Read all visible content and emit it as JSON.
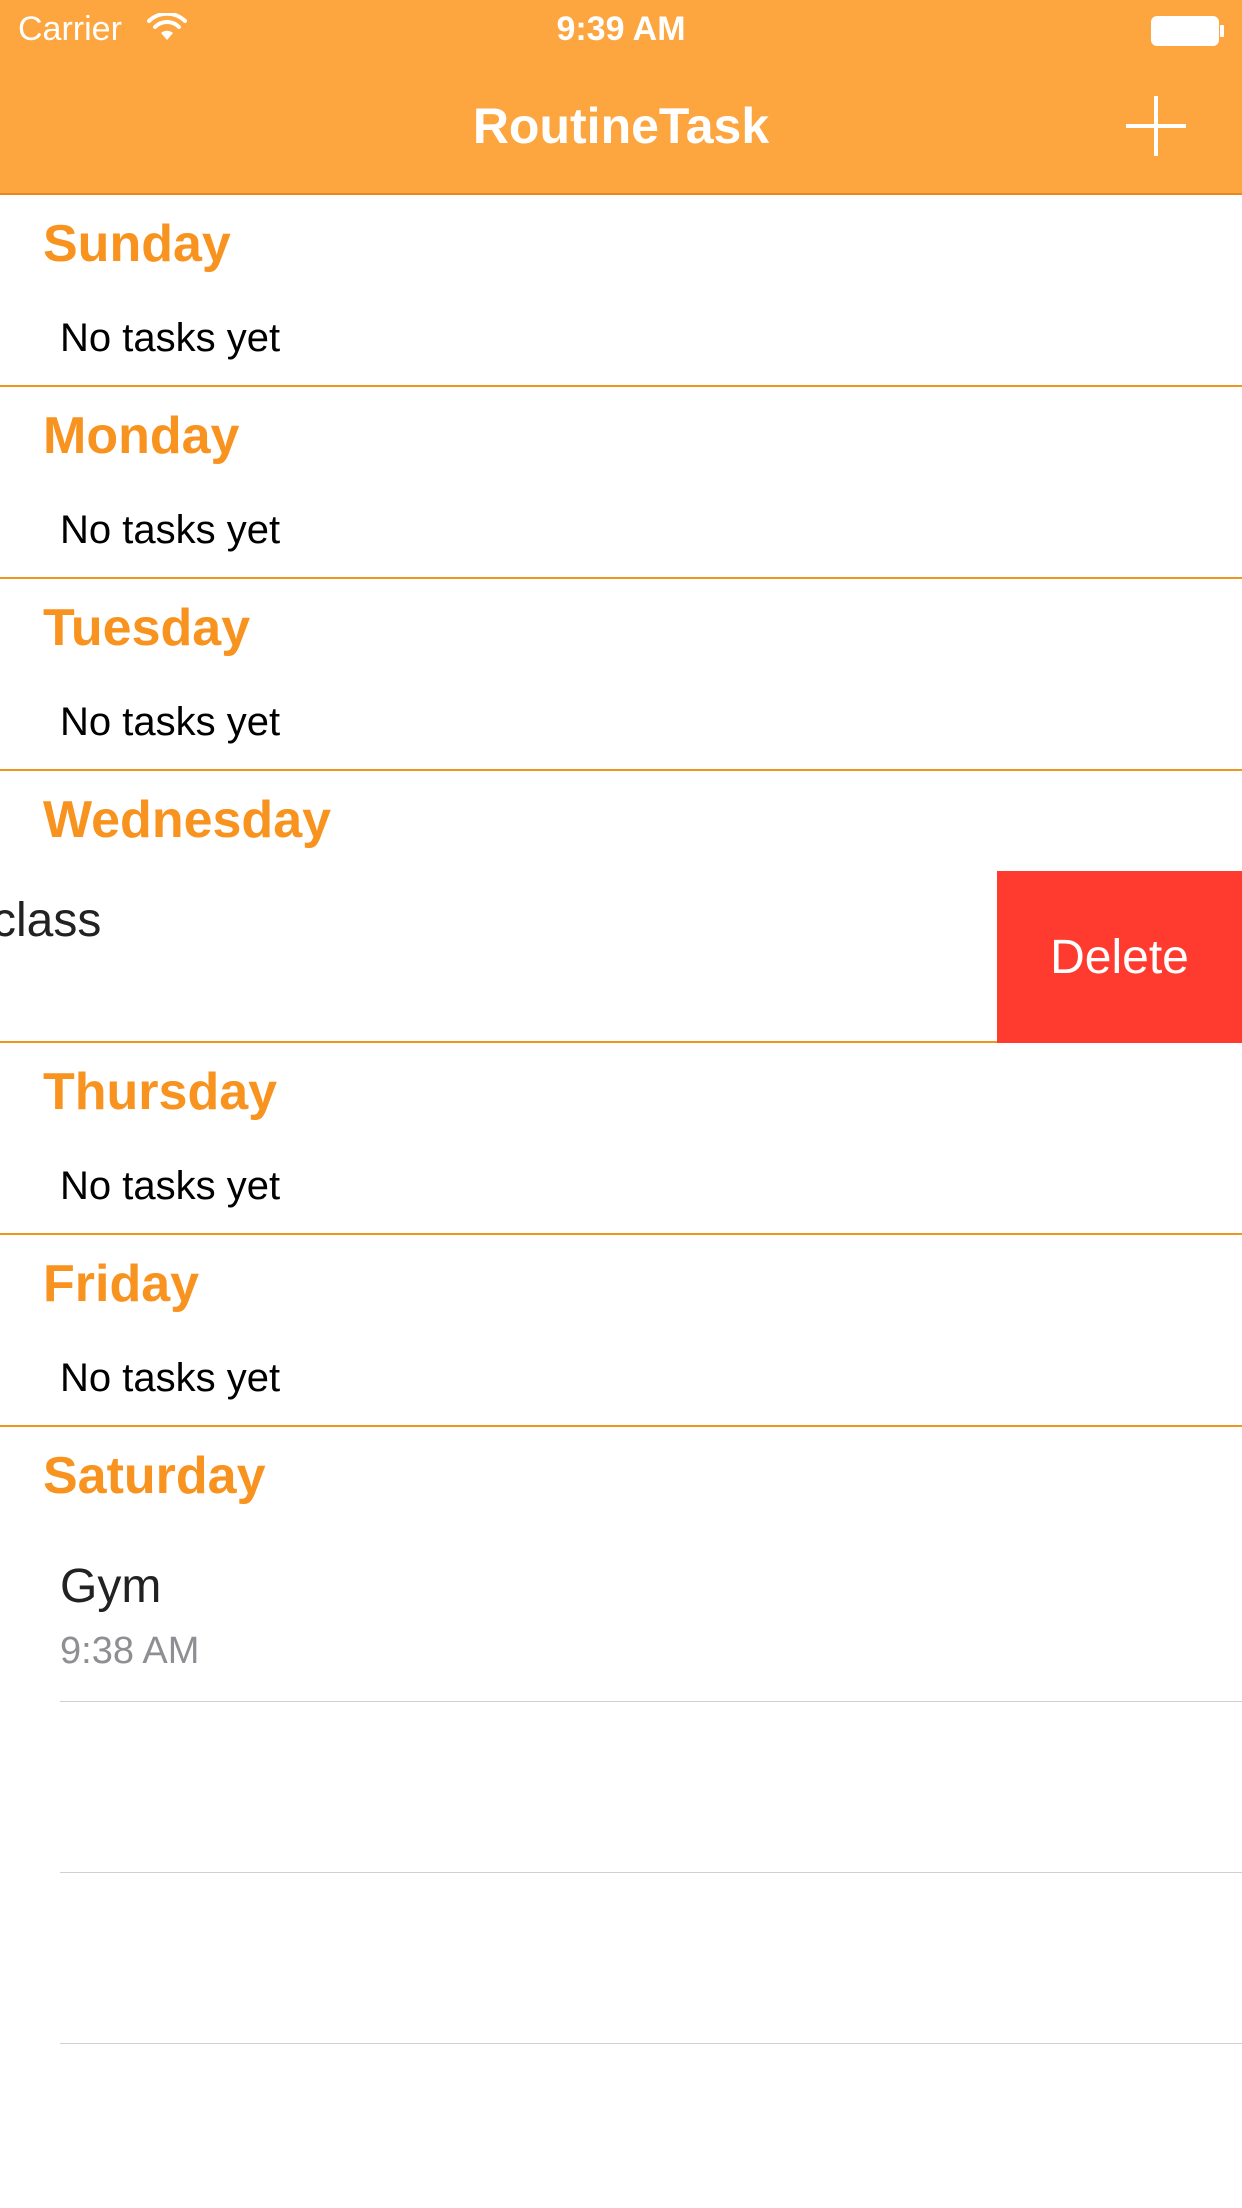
{
  "status_bar": {
    "carrier": "Carrier",
    "time": "9:39 AM"
  },
  "nav": {
    "title": "RoutineTask",
    "add_icon": "plus-icon"
  },
  "colors": {
    "accent": "#FDA53F",
    "section_header": "#F7931E",
    "delete": "#FF3B30"
  },
  "sections": [
    {
      "name": "Sunday",
      "empty_text": "No tasks yet"
    },
    {
      "name": "Monday",
      "empty_text": "No tasks yet"
    },
    {
      "name": "Tuesday",
      "empty_text": "No tasks yet"
    },
    {
      "name": "Wednesday",
      "task_partial_title": "class",
      "delete_label": "Delete"
    },
    {
      "name": "Thursday",
      "empty_text": "No tasks yet"
    },
    {
      "name": "Friday",
      "empty_text": "No tasks yet"
    },
    {
      "name": "Saturday",
      "task": {
        "title": "Gym",
        "time": "9:38 AM"
      }
    }
  ]
}
